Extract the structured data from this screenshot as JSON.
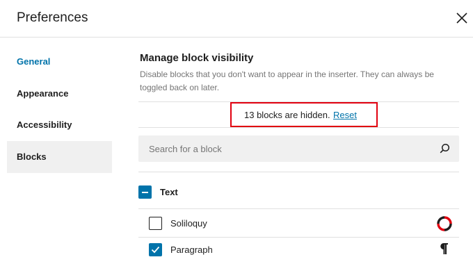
{
  "modal": {
    "title": "Preferences",
    "close_icon": "close-icon"
  },
  "sidebar": {
    "items": [
      {
        "label": "General",
        "state": "active"
      },
      {
        "label": "Appearance",
        "state": "normal"
      },
      {
        "label": "Accessibility",
        "state": "normal"
      },
      {
        "label": "Blocks",
        "state": "selected"
      }
    ]
  },
  "main": {
    "section_title": "Manage block visibility",
    "description": "Disable blocks that you don't want to appear in the inserter. They can always be toggled back on later.",
    "hidden_notice": "13 blocks are hidden.",
    "reset_label": "Reset",
    "search": {
      "placeholder": "Search for a block",
      "value": ""
    },
    "categories": [
      {
        "label": "Text",
        "checkbox_state": "mixed",
        "blocks": [
          {
            "label": "Soliloquy",
            "checked": false,
            "icon": "soliloquy-logo-icon"
          },
          {
            "label": "Paragraph",
            "checked": true,
            "icon": "paragraph-icon"
          }
        ]
      }
    ]
  },
  "colors": {
    "accent": "#0073aa",
    "highlight_border": "#e1000f",
    "sidebar_selected_bg": "#f0f0f0",
    "text": "#1e1e1e",
    "muted_text": "#757575",
    "divider": "#e0e0e0"
  }
}
